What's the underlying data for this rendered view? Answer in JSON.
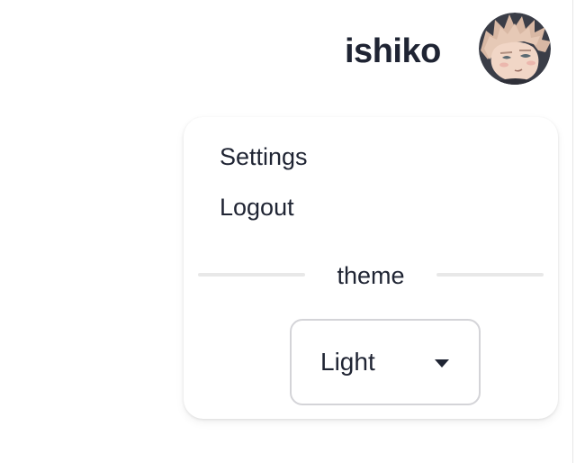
{
  "header": {
    "username": "ishiko",
    "avatar_icon": "anime-avatar-image"
  },
  "menu": {
    "items": [
      {
        "label": "Settings"
      },
      {
        "label": "Logout"
      }
    ],
    "divider_label": "theme",
    "theme_select": {
      "value": "Light",
      "caret_icon": "caret-down-icon"
    }
  },
  "colors": {
    "text": "#1f2433",
    "divider": "#e8e8e8",
    "select_border": "#d4d4d8",
    "background": "#ffffff"
  }
}
